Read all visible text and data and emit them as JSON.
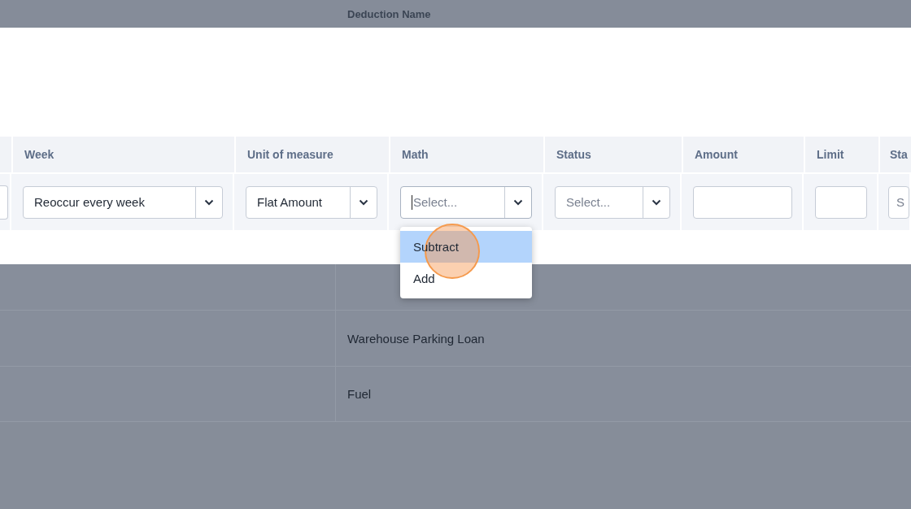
{
  "background_table": {
    "header": "Deduction Name",
    "rows": [
      "",
      "Warehouse Parking Loan",
      "Fuel"
    ]
  },
  "form": {
    "columns": [
      {
        "kind": "input"
      },
      {
        "kind": "select",
        "label": "Week",
        "value": "Reoccur every week",
        "focused": false
      },
      {
        "kind": "select",
        "label": "Unit of measure",
        "value": "Flat Amount",
        "focused": false
      },
      {
        "kind": "select",
        "label": "Math",
        "placeholder": "Select...",
        "focused": true,
        "menu": [
          {
            "label": "Subtract",
            "selected": true
          },
          {
            "label": "Add",
            "selected": false
          }
        ]
      },
      {
        "kind": "select",
        "label": "Status",
        "placeholder": "Select...",
        "focused": false
      },
      {
        "kind": "input",
        "label": "Amount"
      },
      {
        "kind": "input",
        "label": "Limit"
      },
      {
        "kind": "input",
        "label": "Sta",
        "placeholder": "S"
      }
    ]
  }
}
